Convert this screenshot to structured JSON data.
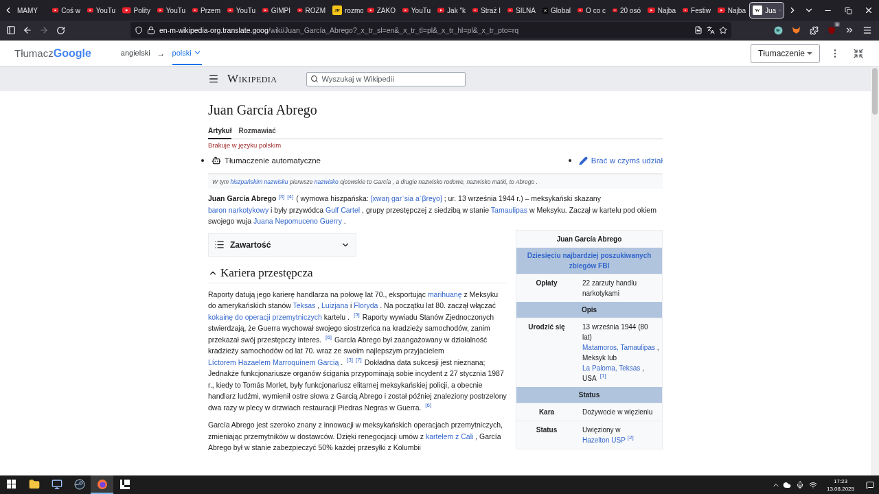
{
  "browser": {
    "tabs": [
      {
        "title": "MAMY",
        "kind": "none",
        "selected": false
      },
      {
        "title": "Coś w",
        "kind": "youtube",
        "selected": false
      },
      {
        "title": "YouTu",
        "kind": "youtube",
        "selected": false
      },
      {
        "title": "Polity",
        "kind": "youtube",
        "selected": false
      },
      {
        "title": "YouTu",
        "kind": "youtube",
        "selected": false
      },
      {
        "title": "Przem",
        "kind": "youtube",
        "selected": false
      },
      {
        "title": "YouTu",
        "kind": "youtube",
        "selected": false
      },
      {
        "title": "GIMPI",
        "kind": "youtube",
        "selected": false
      },
      {
        "title": "ROZM",
        "kind": "youtube",
        "selected": false
      },
      {
        "title": "rozmo",
        "kind": "letter",
        "badge": "JP",
        "selected": false
      },
      {
        "title": "ZAKO",
        "kind": "youtube",
        "selected": false
      },
      {
        "title": "YouTu",
        "kind": "youtube",
        "selected": false
      },
      {
        "title": "Jak \"k",
        "kind": "youtube",
        "selected": false
      },
      {
        "title": "Straż I",
        "kind": "youtube",
        "selected": false
      },
      {
        "title": "SILNA",
        "kind": "youtube",
        "selected": false
      },
      {
        "title": "Global",
        "kind": "x",
        "selected": false
      },
      {
        "title": "O co c",
        "kind": "youtube",
        "selected": false
      },
      {
        "title": "20 osó",
        "kind": "youtube",
        "selected": false
      },
      {
        "title": "Najba",
        "kind": "youtube",
        "selected": false
      },
      {
        "title": "Festiw",
        "kind": "youtube",
        "selected": false
      },
      {
        "title": "Najba",
        "kind": "youtube",
        "selected": false
      },
      {
        "title": "Jua",
        "kind": "letter",
        "badge": "W",
        "selected": true
      }
    ],
    "address": {
      "host": "en-m-wikipedia-org.translate.goog",
      "path": "/wiki/Juan_García_Abrego?_x_tr_sl=en&_x_tr_tl=pl&_x_tr_hl=pl&_x_tr_pto=rq"
    },
    "extension_badge": "9"
  },
  "translate_bar": {
    "logo_prefix": "Tłumacz",
    "logo_brand": "Google",
    "arrow": "→",
    "languages": [
      {
        "label": "angielski",
        "selected": false
      },
      {
        "label": "polski",
        "selected": true
      }
    ],
    "mode_button": "Tłumaczenie"
  },
  "wiki": {
    "logo": "Wikipedia",
    "search_placeholder": "Wyszukaj w Wikipedii",
    "title": "Juan García Abrego",
    "tabs": [
      {
        "label": "Artykuł",
        "selected": true
      },
      {
        "label": "Rozmawiać",
        "selected": false
      }
    ],
    "missing_notice": "Brakuje w języku polskim",
    "machine_translation": "Tłumaczenie automatyczne",
    "contribute": "Brać w czymś udział",
    "hatnote": [
      {
        "kind": "text",
        "text": "W tym "
      },
      {
        "kind": "link",
        "text": "hiszpańskim nazwisku"
      },
      {
        "kind": "text",
        "text": " pierwsze "
      },
      {
        "kind": "link",
        "text": "nazwisko"
      },
      {
        "kind": "text",
        "text": " ojcowskie to García , a drugie nazwisko rodowe, nazwisko matki, to Abrego ."
      }
    ],
    "intro": [
      {
        "kind": "bold",
        "text": "Juan García Abrego"
      },
      {
        "kind": "ref",
        "text": "[3]"
      },
      {
        "kind": "ref",
        "text": "[4]"
      },
      {
        "kind": "text",
        "text": " ( wymowa hiszpańska: "
      },
      {
        "kind": "link",
        "text": "[xwaŋ ɡarˈsia aˈβreɣo]"
      },
      {
        "kind": "text",
        "text": " ; ur. 13 września 1944 r.) – meksykański skazany "
      },
      {
        "kind": "link",
        "text": "baron narkotykowy"
      },
      {
        "kind": "text",
        "text": " i były przywódca "
      },
      {
        "kind": "link",
        "text": "Gulf Cartel"
      },
      {
        "kind": "text",
        "text": " , grupy przestępczej z siedzibą w stanie "
      },
      {
        "kind": "link",
        "text": "Tamaulipas"
      },
      {
        "kind": "text",
        "text": " w Meksyku. Zaczął w kartelu pod okiem swojego wuja "
      },
      {
        "kind": "link",
        "text": "Juana Nepomuceno Guerry"
      },
      {
        "kind": "text",
        "text": " ."
      }
    ],
    "toc": {
      "label": "Zawartość",
      "expanded": false
    },
    "section": {
      "title": "Kariera przestępcza",
      "expanded": true
    },
    "paragraphs": [
      [
        {
          "kind": "text",
          "text": "Raporty datują jego karierę handlarza na połowę lat 70., eksportując "
        },
        {
          "kind": "link",
          "text": "marihuanę"
        },
        {
          "kind": "text",
          "text": " z Meksyku do amerykańskich stanów "
        },
        {
          "kind": "link",
          "text": "Teksas"
        },
        {
          "kind": "text",
          "text": " , "
        },
        {
          "kind": "link",
          "text": "Luizjana"
        },
        {
          "kind": "text",
          "text": " i "
        },
        {
          "kind": "link",
          "text": "Floryda"
        },
        {
          "kind": "text",
          "text": " . Na początku lat 80. zaczął włączać "
        },
        {
          "kind": "link",
          "text": "kokainę do operacji przemytniczych"
        },
        {
          "kind": "text",
          "text": " kartelu . "
        },
        {
          "kind": "ref",
          "text": "[5]"
        },
        {
          "kind": "text",
          "text": " Raporty wywiadu Stanów Zjednoczonych stwierdzają, że Guerra wychował swojego siostrzeńca na kradzieży samochodów, zanim przekazał swój przestępczy interes. "
        },
        {
          "kind": "ref",
          "text": "[6]"
        },
        {
          "kind": "text",
          "text": " García Abrego był zaangażowany w działalność kradzieży samochodów od lat 70. wraz ze swoim najlepszym przyjacielem "
        },
        {
          "kind": "link",
          "text": "Líctorem Hazaelem Marroquínem Garcią"
        },
        {
          "kind": "text",
          "text": " . "
        },
        {
          "kind": "ref",
          "text": "[3]"
        },
        {
          "kind": "ref",
          "text": "[7]"
        },
        {
          "kind": "text",
          "text": " Dokładna data sukcesji jest nieznana; Jednakże funkcjonariusze organów ścigania przypominają sobie incydent z 27 stycznia 1987 r., kiedy to Tomás Morlet, były funkcjonariusz elitarnej meksykańskiej policji, a obecnie handlarz ludźmi, wymienił ostre słowa z Garcią Abrego i został później znaleziony postrzelony dwa razy w plecy w drzwiach restauracji Piedras Negras w Guerra. "
        },
        {
          "kind": "ref",
          "text": "[6]"
        }
      ],
      [
        {
          "kind": "text",
          "text": "García Abrego jest szeroko znany z innowacji w meksykańskich operacjach przemytniczych, zmieniając przemytników w dostawców. Dzięki renegocjacji umów z "
        },
        {
          "kind": "link",
          "text": "kartelem z Cali"
        },
        {
          "kind": "text",
          "text": " , García Abrego był w stanie zabezpieczyć 50% każdej przesyłki z Kolumbii"
        }
      ]
    ],
    "infobox": {
      "title": "Juan García Abrego",
      "rows": [
        {
          "kind": "link-heading",
          "text": "Dziesięciu najbardziej poszukiwanych zbiegów FBI"
        },
        {
          "kind": "field",
          "label": "Opłaty",
          "value": [
            {
              "kind": "text",
              "text": "22 zarzuty handlu narkotykami"
            }
          ]
        },
        {
          "kind": "heading",
          "text": "Opis"
        },
        {
          "kind": "field",
          "label": "Urodzić się",
          "value": [
            {
              "kind": "text",
              "text": "13 września 1944 (80 lat) "
            },
            {
              "kind": "link",
              "text": "Matamoros, Tamaulipas"
            },
            {
              "kind": "text",
              "text": " , Meksyk lub "
            },
            {
              "kind": "link",
              "text": "La Paloma, Teksas"
            },
            {
              "kind": "text",
              "text": " , USA "
            },
            {
              "kind": "ref",
              "text": "[1]"
            }
          ]
        },
        {
          "kind": "heading",
          "text": "Status"
        },
        {
          "kind": "field",
          "label": "Kara",
          "value": [
            {
              "kind": "text",
              "text": "Dożywocie w więzieniu"
            }
          ]
        },
        {
          "kind": "field",
          "label": "Status",
          "value": [
            {
              "kind": "text",
              "text": "Uwięziony w "
            },
            {
              "kind": "link",
              "text": "Hazelton USP"
            },
            {
              "kind": "ref",
              "text": "[2]"
            }
          ]
        }
      ]
    }
  },
  "taskbar": {
    "time": "17:23",
    "date": "13.08.2025",
    "apps": [
      {
        "kind": "explorer",
        "selected": false
      },
      {
        "kind": "remote",
        "selected": false
      },
      {
        "kind": "steam",
        "selected": false
      },
      {
        "kind": "firefox",
        "selected": true
      },
      {
        "kind": "notes",
        "selected": false
      }
    ]
  }
}
